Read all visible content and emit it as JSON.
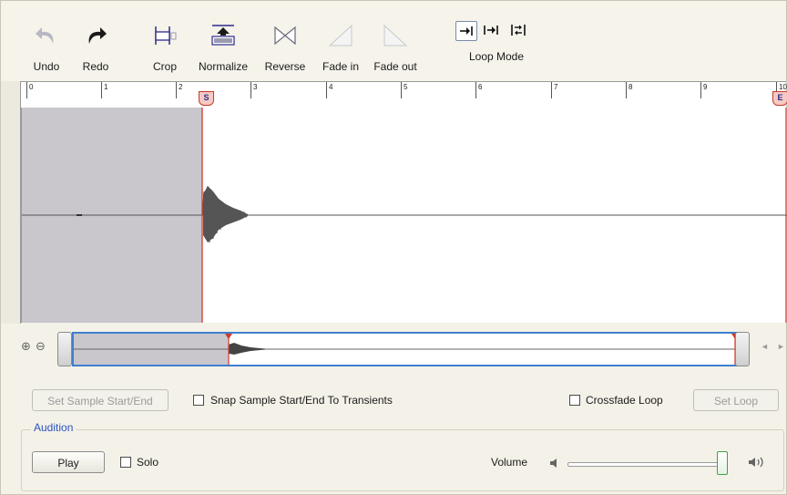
{
  "toolbar": {
    "undo": "Undo",
    "redo": "Redo",
    "crop": "Crop",
    "normalize": "Normalize",
    "reverse": "Reverse",
    "fade_in": "Fade in",
    "fade_out": "Fade out",
    "loop_mode": "Loop Mode"
  },
  "ruler": {
    "ticks": [
      "0",
      "1",
      "2",
      "3",
      "4",
      "5",
      "6",
      "7",
      "8",
      "9",
      "10"
    ],
    "start_marker": "S",
    "end_marker": "E"
  },
  "controls": {
    "set_sample_start_end": "Set Sample Start/End",
    "snap_label": "Snap Sample Start/End To Transients",
    "crossfade_loop": "Crossfade Loop",
    "set_loop": "Set Loop"
  },
  "audition": {
    "title": "Audition",
    "play": "Play",
    "solo": "Solo",
    "volume": "Volume",
    "volume_level": 1.0
  },
  "colors": {
    "accent": "#3f7fd0",
    "marker": "#d23a2a",
    "waveform": "#555555",
    "unselected": "#c9c6cc"
  }
}
